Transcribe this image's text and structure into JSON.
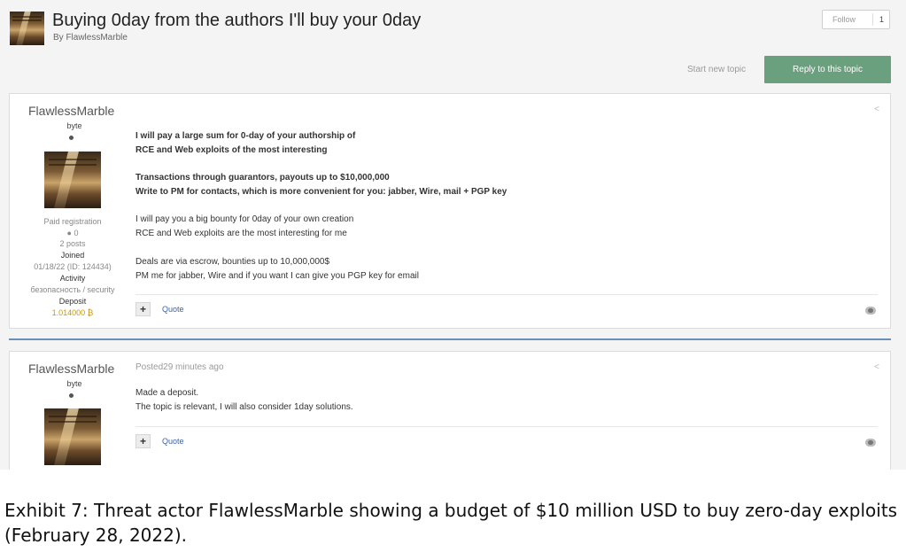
{
  "topic": {
    "title": "Buying 0day from the authors I'll buy your 0day",
    "byline": "By FlawlessMarble",
    "follow_label": "Follow",
    "follow_count": "1",
    "start_new_topic": "Start new topic",
    "reply_label": "Reply to this topic"
  },
  "post1": {
    "author": "FlawlessMarble",
    "rank": "byte",
    "group": "Paid registration",
    "reputation": "0",
    "posts": "2 posts",
    "joined_label": "Joined",
    "joined_value": "01/18/22 (ID: 124434)",
    "activity_label": "Activity",
    "activity_value": "безопасность / security",
    "deposit_label": "Deposit",
    "deposit_value": "1.014000 ₿",
    "lines_bold": [
      "I will pay a large sum for 0-day of your authorship of",
      "RCE and Web exploits of the most interesting",
      "Transactions through guarantors, payouts up to $10,000,000",
      "Write to PM for contacts, which is more convenient for you: jabber, Wire, mail + PGP key"
    ],
    "lines": [
      "I will pay you a big bounty for 0day of your own creation",
      "RCE and Web exploits are the most interesting for me",
      "Deals are via escrow, bounties up to 10,000,000$",
      "PM me for jabber, Wire and if you want I can give you PGP key for email"
    ],
    "plus": "+",
    "quote": "Quote"
  },
  "post2": {
    "author": "FlawlessMarble",
    "rank": "byte",
    "posted": "Posted29 minutes ago",
    "lines": [
      "Made a deposit.",
      "The topic is relevant, I will also consider 1day solutions."
    ],
    "plus": "+",
    "quote": "Quote"
  },
  "caption": "Exhibit 7: Threat actor FlawlessMarble showing a budget of $10 million USD to buy zero-day exploits (February 28, 2022).",
  "icons": [
    "share-icon",
    "reaction-icon",
    "avatar-image"
  ],
  "colors": {
    "reply_button": "#6aa07e",
    "link": "#3a64a6",
    "deposit": "#c9960d",
    "divider": "#6c8fb6"
  }
}
